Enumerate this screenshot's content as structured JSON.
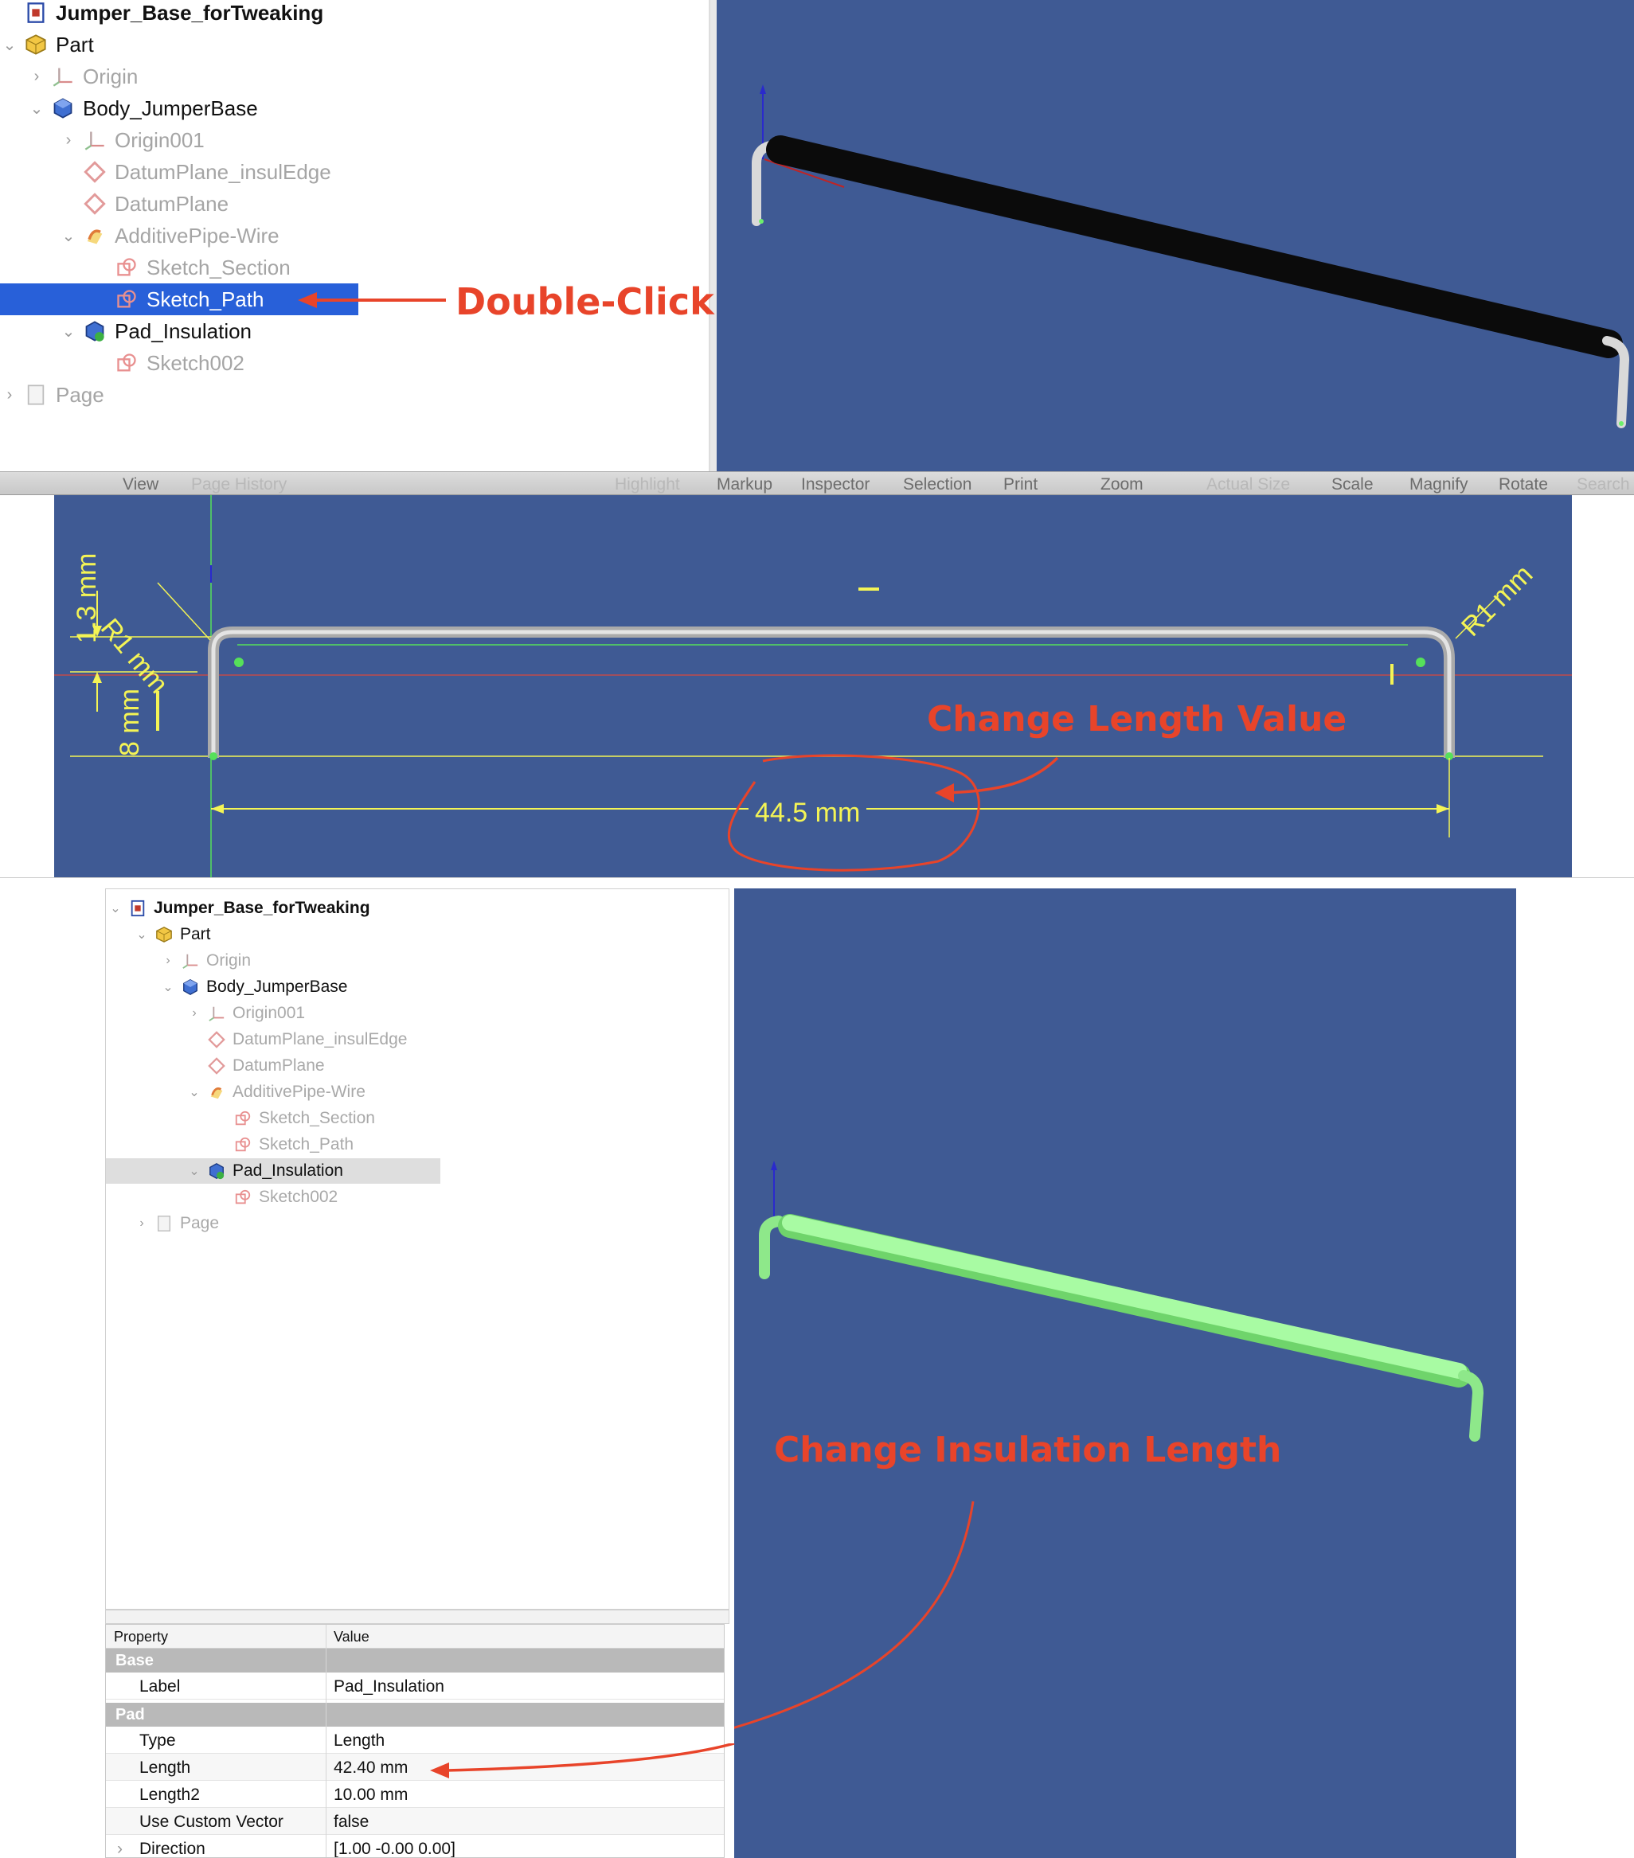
{
  "panel1": {
    "tree": [
      {
        "label": "Jumper_Base_forTweaking",
        "icon": "document-icon",
        "level": 0,
        "chevron": "",
        "bold": true,
        "dim": false
      },
      {
        "label": "Part",
        "icon": "part-icon",
        "level": 0,
        "chevron": "⌄",
        "bold": false,
        "dim": false
      },
      {
        "label": "Origin",
        "icon": "origin-icon",
        "level": 1,
        "chevron": "›",
        "bold": false,
        "dim": true
      },
      {
        "label": "Body_JumperBase",
        "icon": "body-icon",
        "level": 1,
        "chevron": "⌄",
        "bold": false,
        "dim": false
      },
      {
        "label": "Origin001",
        "icon": "origin-icon",
        "level": 2,
        "chevron": "›",
        "bold": false,
        "dim": true
      },
      {
        "label": "DatumPlane_insulEdge",
        "icon": "datum-plane-icon",
        "level": 2,
        "chevron": "",
        "bold": false,
        "dim": true
      },
      {
        "label": "DatumPlane",
        "icon": "datum-plane-icon",
        "level": 2,
        "chevron": "",
        "bold": false,
        "dim": true
      },
      {
        "label": "AdditivePipe-Wire",
        "icon": "additive-pipe-icon",
        "level": 2,
        "chevron": "⌄",
        "bold": false,
        "dim": true
      },
      {
        "label": "Sketch_Section",
        "icon": "sketch-icon",
        "level": 3,
        "chevron": "",
        "bold": false,
        "dim": true
      },
      {
        "label": "Sketch_Path",
        "icon": "sketch-icon",
        "level": 3,
        "chevron": "",
        "bold": false,
        "dim": false,
        "selected": true
      },
      {
        "label": "Pad_Insulation",
        "icon": "pad-icon",
        "level": 2,
        "chevron": "⌄",
        "bold": false,
        "dim": false
      },
      {
        "label": "Sketch002",
        "icon": "sketch-icon",
        "level": 3,
        "chevron": "",
        "bold": false,
        "dim": true
      },
      {
        "label": "Page",
        "icon": "page-icon",
        "level": 0,
        "chevron": "›",
        "bold": false,
        "dim": true
      }
    ],
    "annotation": "Double-Click"
  },
  "panel2": {
    "toolbar": [
      {
        "label": "View",
        "faded": false
      },
      {
        "label": "Page History",
        "faded": true
      },
      {
        "label": "Highlight",
        "faded": true
      },
      {
        "label": "Markup",
        "faded": false
      },
      {
        "label": "Inspector",
        "faded": false
      },
      {
        "label": "Selection",
        "faded": false
      },
      {
        "label": "Print",
        "faded": false
      },
      {
        "label": "Zoom",
        "faded": false
      },
      {
        "label": "Actual Size",
        "faded": true
      },
      {
        "label": "Scale",
        "faded": false
      },
      {
        "label": "Magnify",
        "faded": false
      },
      {
        "label": "Rotate",
        "faded": false
      },
      {
        "label": "Search",
        "faded": true
      }
    ],
    "dimensions": {
      "radius_left": "R1 mm",
      "radius_right": "R1 mm",
      "offset_top": "1.3 mm",
      "height_left": "8 mm",
      "length": "44.5 mm"
    },
    "annotation": "Change Length Value"
  },
  "panel3": {
    "tree": [
      {
        "label": "Jumper_Base_forTweaking",
        "icon": "document-icon",
        "level": 0,
        "chevron": "⌄",
        "bold": true,
        "dim": false
      },
      {
        "label": "Part",
        "icon": "part-icon",
        "level": 1,
        "chevron": "⌄",
        "bold": false,
        "dim": false
      },
      {
        "label": "Origin",
        "icon": "origin-icon",
        "level": 2,
        "chevron": "›",
        "bold": false,
        "dim": true
      },
      {
        "label": "Body_JumperBase",
        "icon": "body-icon",
        "level": 2,
        "chevron": "⌄",
        "bold": false,
        "dim": false
      },
      {
        "label": "Origin001",
        "icon": "origin-icon",
        "level": 3,
        "chevron": "›",
        "bold": false,
        "dim": true
      },
      {
        "label": "DatumPlane_insulEdge",
        "icon": "datum-plane-icon",
        "level": 3,
        "chevron": "",
        "bold": false,
        "dim": true
      },
      {
        "label": "DatumPlane",
        "icon": "datum-plane-icon",
        "level": 3,
        "chevron": "",
        "bold": false,
        "dim": true
      },
      {
        "label": "AdditivePipe-Wire",
        "icon": "additive-pipe-icon",
        "level": 3,
        "chevron": "⌄",
        "bold": false,
        "dim": true
      },
      {
        "label": "Sketch_Section",
        "icon": "sketch-icon",
        "level": 4,
        "chevron": "",
        "bold": false,
        "dim": true
      },
      {
        "label": "Sketch_Path",
        "icon": "sketch-icon",
        "level": 4,
        "chevron": "",
        "bold": false,
        "dim": true
      },
      {
        "label": "Pad_Insulation",
        "icon": "pad-icon",
        "level": 3,
        "chevron": "⌄",
        "bold": false,
        "dim": false,
        "highlighted": true
      },
      {
        "label": "Sketch002",
        "icon": "sketch-icon",
        "level": 4,
        "chevron": "",
        "bold": false,
        "dim": true
      },
      {
        "label": "Page",
        "icon": "page-icon",
        "level": 1,
        "chevron": "›",
        "bold": false,
        "dim": true
      }
    ],
    "properties": {
      "header_property": "Property",
      "header_value": "Value",
      "group_base": "Base",
      "group_pad": "Pad",
      "rows_base": [
        {
          "key": "Label",
          "value": "Pad_Insulation"
        }
      ],
      "rows_pad": [
        {
          "key": "Type",
          "value": "Length"
        },
        {
          "key": "Length",
          "value": "42.40 mm"
        },
        {
          "key": "Length2",
          "value": "10.00 mm"
        },
        {
          "key": "Use Custom Vector",
          "value": "false"
        },
        {
          "key": "Direction",
          "value": "[1.00 -0.00 0.00]"
        }
      ]
    },
    "annotation": "Change Insulation Length"
  },
  "colors": {
    "viewport": "#3f5a94",
    "selection": "#2860d9",
    "annotation": "#e8442a",
    "dimension": "#f4f455",
    "insulation_black": "#0b0b0b",
    "insulation_green": "#9ef59a"
  }
}
